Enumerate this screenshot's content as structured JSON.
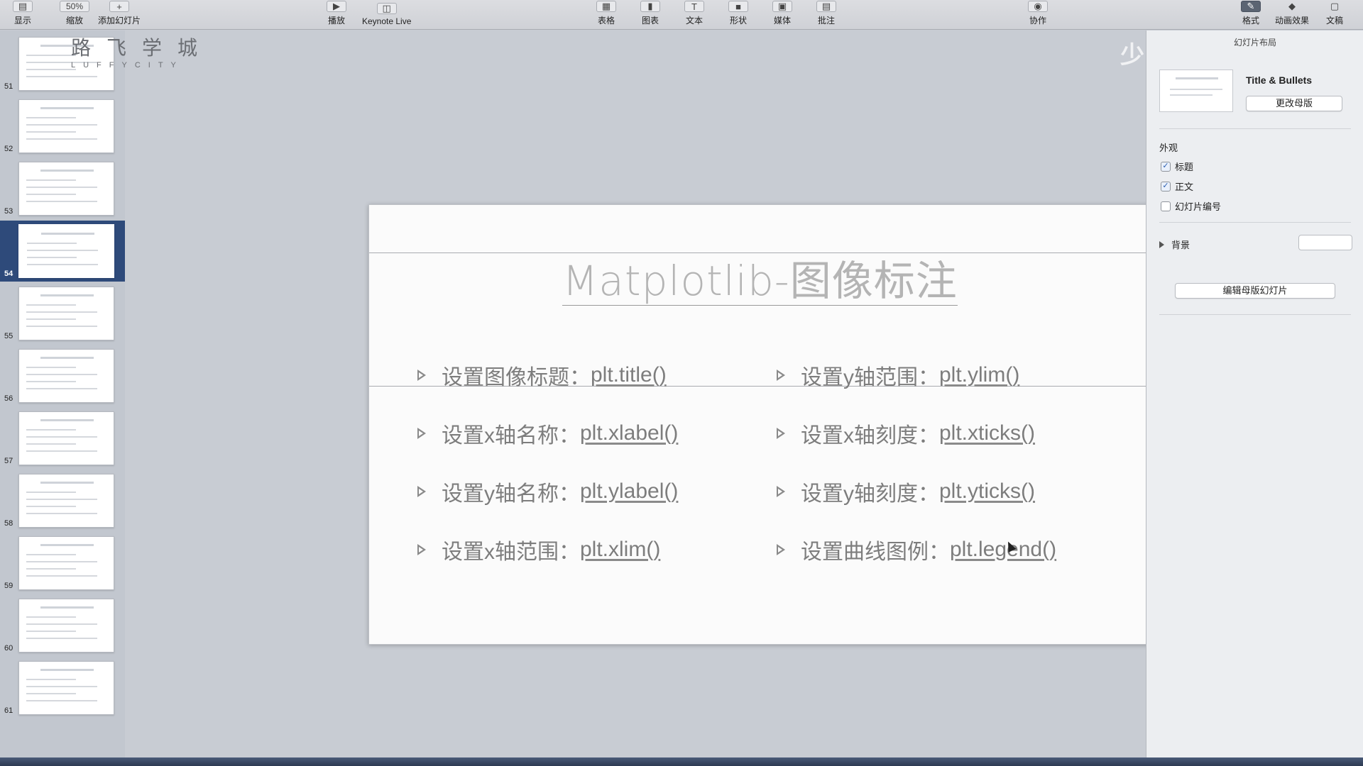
{
  "toolbar": {
    "view": "显示",
    "zoom_value": "50%",
    "zoom": "缩放",
    "add_slide": "添加幻灯片",
    "play": "播放",
    "keynote_live": "Keynote Live",
    "table": "表格",
    "chart": "图表",
    "text": "文本",
    "shape": "形状",
    "media": "媒体",
    "comment": "批注",
    "collaborate": "协作",
    "format": "格式",
    "animate": "动画效果",
    "document": "文稿"
  },
  "brand": {
    "cn": "路飞学城",
    "en": "LUFFYCITY"
  },
  "navigator": {
    "slides": [
      {
        "num": "51"
      },
      {
        "num": "52"
      },
      {
        "num": "53"
      },
      {
        "num": "54",
        "selected": true
      },
      {
        "num": "55"
      },
      {
        "num": "56"
      },
      {
        "num": "57"
      },
      {
        "num": "58"
      },
      {
        "num": "59"
      },
      {
        "num": "60"
      },
      {
        "num": "61"
      }
    ]
  },
  "slide": {
    "title": "Matplotlib-图像标注",
    "bullets": [
      {
        "label": "设置图像标题：",
        "code": "plt.title()"
      },
      {
        "label": "设置y轴范围：",
        "code": "plt.ylim()"
      },
      {
        "label": "设置x轴名称：",
        "code": "plt.xlabel()"
      },
      {
        "label": "设置x轴刻度：",
        "code": "plt.xticks()"
      },
      {
        "label": "设置y轴名称：",
        "code": "plt.ylabel()"
      },
      {
        "label": "设置y轴刻度：",
        "code": "plt.yticks()"
      },
      {
        "label": "设置x轴范围：",
        "code": "plt.xlim()"
      },
      {
        "label": "设置曲线图例：",
        "code": "plt.legend()"
      }
    ]
  },
  "inspector": {
    "header": "幻灯片布局",
    "layout_name": "Title & Bullets",
    "change_master": "更改母版",
    "appearance": "外观",
    "opt_title": "标题",
    "opt_body": "正文",
    "opt_slide_number": "幻灯片编号",
    "background": "背景",
    "edit_master": "编辑母版幻灯片"
  },
  "watermark": "少"
}
